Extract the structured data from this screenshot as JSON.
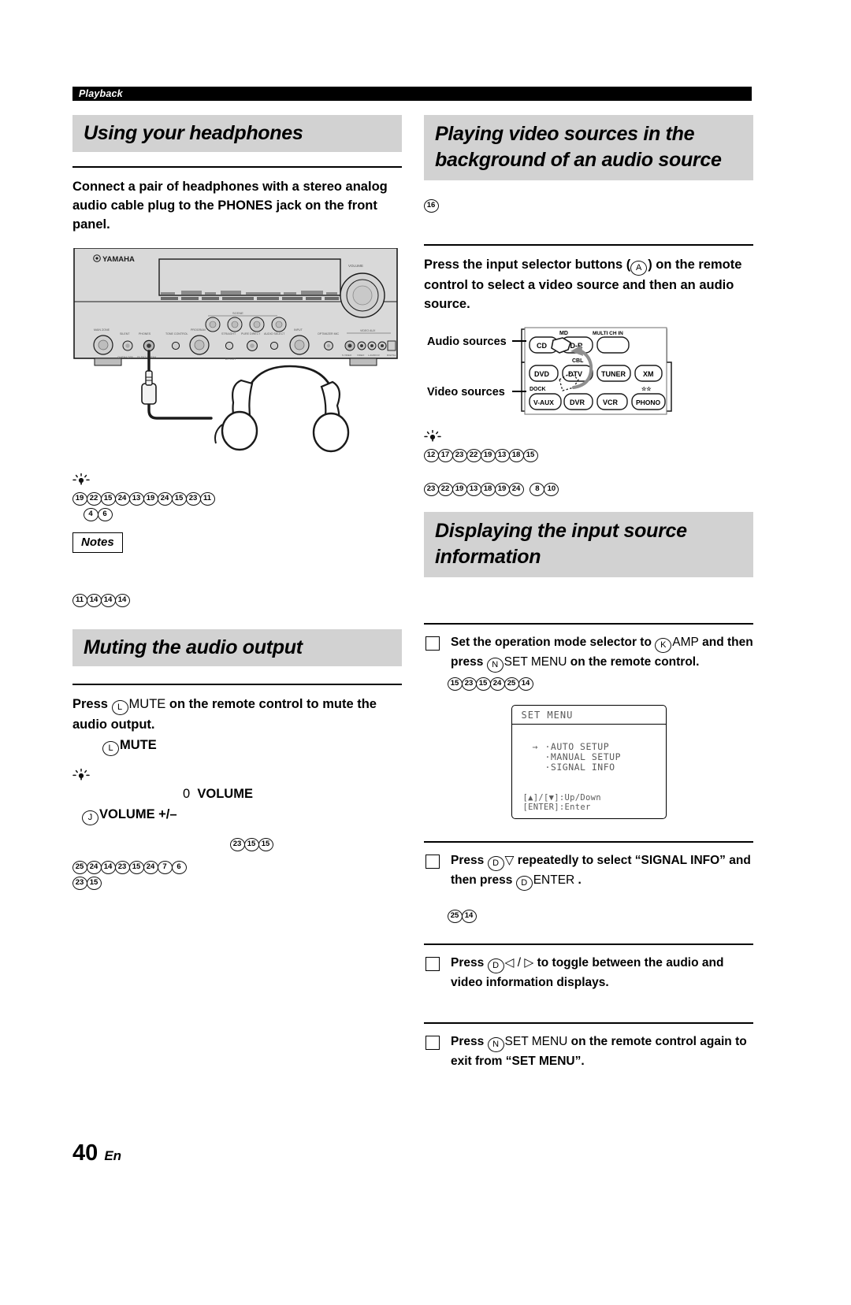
{
  "running_head": "Playback",
  "page_footer": {
    "number": "40",
    "lang": "En"
  },
  "left_column": {
    "section1": {
      "heading": "Using your headphones",
      "lead": "Connect a pair of headphones with a stereo analog audio cable plug to the PHONES jack on the front panel.",
      "illustration": {
        "name": "receiver-front-panel",
        "brand": "YAMAHA",
        "knob_label": "VOLUME"
      },
      "tip_refs_line1": [
        "19",
        "22",
        "15",
        "24",
        "13",
        "19",
        "24",
        "15",
        "23",
        "11"
      ],
      "tip_refs_line2": [
        "4",
        "6"
      ],
      "notes_label": "Notes",
      "notes_refs": [
        "11",
        "14",
        "14",
        "14"
      ]
    },
    "section2": {
      "heading": "Muting the audio output",
      "lead_pre": "Press ",
      "lead_marker": "L",
      "lead_mid": "MUTE",
      "lead_post": " on the remote control to mute the audio output.",
      "sub_marker": "L",
      "sub_label": "MUTE",
      "tip_value": "0",
      "tip_label": "VOLUME",
      "tip_marker": "J",
      "tip_marker_label": "VOLUME +/–",
      "tip_refs_right": [
        "23",
        "15",
        "15"
      ],
      "tip_refs_line": [
        "25",
        "24",
        "14",
        "23",
        "15",
        "24",
        "7",
        "6"
      ],
      "tip_refs_line2": [
        "23",
        "15"
      ]
    }
  },
  "right_column": {
    "section1": {
      "heading": "Playing video sources in the background of an audio source",
      "top_ref": "16",
      "lead_pre": "Press the input selector buttons (",
      "lead_marker": "A",
      "lead_post": ") on the remote control to select a video source and then an audio source.",
      "illustration": {
        "name": "remote-input-selector",
        "audio_label": "Audio sources",
        "video_label": "Video sources",
        "buttons_row1": [
          "CD",
          "CD-R",
          "MULTI CH IN"
        ],
        "row1_top_labels": [
          "MD",
          "MULTI CH IN"
        ],
        "buttons_row2": [
          "DVD",
          "DTV",
          "TUNER",
          "XM"
        ],
        "buttons_row3": [
          "V-AUX",
          "DVR",
          "VCR",
          "PHONO"
        ],
        "dock_label": "DOCK",
        "cbl_label": "CBL"
      },
      "tip_refs_line1": [
        "12",
        "17",
        "23",
        "22",
        "19",
        "13",
        "18",
        "15"
      ],
      "tip_refs_line2": [
        "23",
        "22",
        "19",
        "13",
        "18",
        "19",
        "24"
      ],
      "tip_refs_line2b": [
        "8",
        "10"
      ]
    },
    "section2": {
      "heading": "Displaying the input source information",
      "steps": [
        {
          "pre": "Set the operation mode selector to ",
          "marker1": "K",
          "mid1": "AMP",
          "mid2": " and then press ",
          "marker2": "N",
          "mid3": "SET MENU",
          "post": "  on the remote control.",
          "refs": [
            "15",
            "23",
            "15",
            "24",
            "25",
            "14"
          ]
        },
        {
          "pre": "Press ",
          "marker1": "D",
          "mid1": "▽",
          "mid2": " repeatedly to select “SIGNAL INFO” and then press ",
          "marker2": "D",
          "mid3": "ENTER",
          "post": " .",
          "refs": [
            "25",
            "14"
          ]
        },
        {
          "pre": "Press ",
          "marker1": "D",
          "mid1": "◁ / ▷",
          "mid2": " to toggle between the audio and video information displays.",
          "refs": []
        },
        {
          "pre": "Press ",
          "marker1": "N",
          "mid1": "SET MENU",
          "mid2": "  on the remote control again to exit from “SET MENU”.",
          "refs": []
        }
      ],
      "osd": {
        "title": "SET MENU",
        "arrow": "→",
        "items": [
          "·AUTO SETUP",
          "·MANUAL SETUP",
          "·SIGNAL INFO"
        ],
        "footer_line1": "[▲]/[▼]:Up/Down",
        "footer_line2": "[ENTER]:Enter"
      }
    }
  }
}
